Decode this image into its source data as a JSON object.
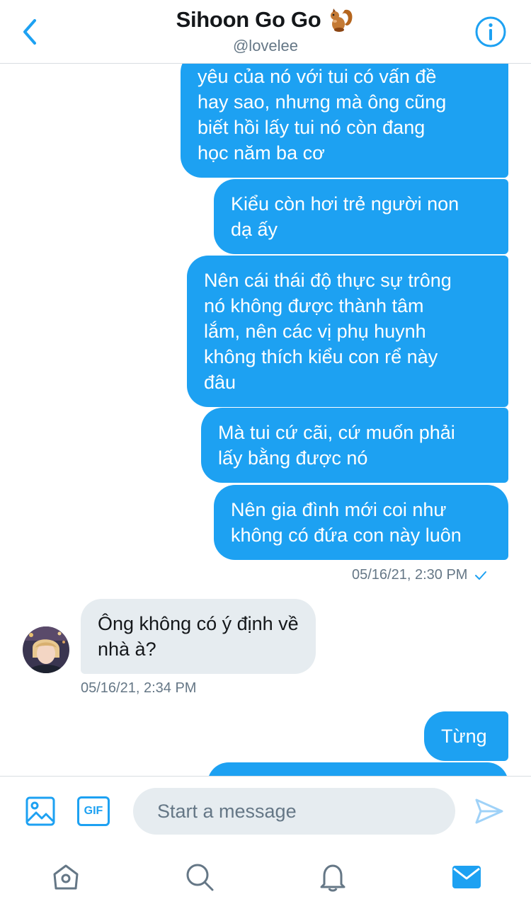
{
  "header": {
    "title": "Sihoon Go Go",
    "handle": "@lovelee",
    "title_emoji": "squirrel-icon"
  },
  "messages": [
    {
      "direction": "outgoing",
      "text": "yêu của nó với tui có vấn đề\nhay sao, nhưng mà ông cũng\nbiết hồi lấy tui nó còn đang\nhọc năm ba cơ"
    },
    {
      "direction": "outgoing",
      "text": "Kiểu còn hơi trẻ người non\ndạ ấy"
    },
    {
      "direction": "outgoing",
      "text": "Nên cái thái độ thực sự trông\nnó không được thành tâm\nlắm, nên các vị phụ huynh\nkhông thích kiểu con rể này\nđâu"
    },
    {
      "direction": "outgoing",
      "text": "Mà tui cứ cãi, cứ muốn phải\nlấy bằng được nó"
    },
    {
      "direction": "outgoing",
      "text": "Nên gia đình mới coi như\nkhông có đứa con này luôn"
    },
    {
      "direction": "incoming",
      "text": "Ông không có ý định về\nnhà à?"
    },
    {
      "direction": "outgoing",
      "text": "Từng"
    }
  ],
  "timestamps": {
    "outgoing_group": "05/16/21, 2:30 PM",
    "incoming": "05/16/21, 2:34 PM"
  },
  "composer": {
    "placeholder": "Start a message",
    "gif_label": "GIF"
  },
  "tabs": [
    "home-icon",
    "search-icon",
    "bell-icon",
    "mail-icon"
  ],
  "colors": {
    "accent": "#1da1f2",
    "incoming_bubble": "#e6ecf0",
    "muted_text": "#657786"
  }
}
